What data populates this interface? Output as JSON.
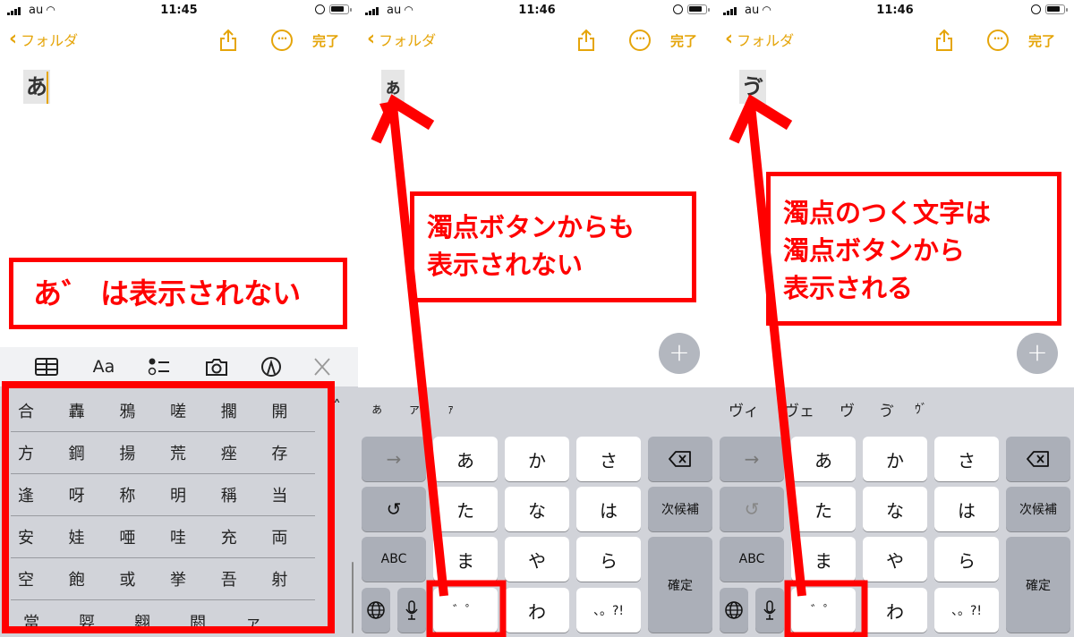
{
  "colors": {
    "accent": "#e5a50a",
    "annotation": "#ff0000",
    "keyboard_bg": "#d1d3d9",
    "key_white": "#ffffff",
    "key_gray": "#abafb8"
  },
  "panels": [
    {
      "status": {
        "carrier": "au",
        "time": "11:45"
      },
      "nav": {
        "back_label": "フォルダ",
        "done_label": "完了"
      },
      "note_text": "あ",
      "toolbar": {
        "icons": [
          "table-icon",
          "text-format-icon",
          "checklist-icon",
          "camera-icon",
          "markup-icon",
          "close-icon"
        ],
        "format_label": "Aa",
        "close_label": "✕"
      },
      "candidates": [
        [
          "合",
          "轟",
          "鴉",
          "嗟",
          "擱",
          "開"
        ],
        [
          "方",
          "鋼",
          "揚",
          "荒",
          "痤",
          "存"
        ],
        [
          "逢",
          "呀",
          "称",
          "明",
          "稱",
          "当"
        ],
        [
          "安",
          "娃",
          "唖",
          "哇",
          "充",
          "両"
        ],
        [
          "空",
          "飽",
          "或",
          "挙",
          "吾",
          "射"
        ],
        [
          "當",
          "娿",
          "翱",
          "閼",
          "ァ"
        ]
      ],
      "callout": [
        "あ゛ は表示されない"
      ]
    },
    {
      "status": {
        "carrier": "au",
        "time": "11:46"
      },
      "nav": {
        "back_label": "フォルダ",
        "done_label": "完了"
      },
      "note_text": "ぁ",
      "candidates": [
        "ぁ",
        "ァ",
        "ｧ"
      ],
      "callout": [
        "濁点ボタンからも",
        "表示されない"
      ]
    },
    {
      "status": {
        "carrier": "au",
        "time": "11:46"
      },
      "nav": {
        "back_label": "フォルダ",
        "done_label": "完了"
      },
      "note_text": "ゔ",
      "candidates": [
        "ヴィ",
        "ヴェ",
        "ヴ",
        "ゔ",
        "ｳﾞ"
      ],
      "callout": [
        "濁点のつく文字は",
        "濁点ボタンから",
        "表示される"
      ]
    }
  ],
  "keyboard": {
    "arrow_label": "→",
    "undo_label": "↺",
    "abc_label": "ABC",
    "next_candidate_label": "次候補",
    "confirm_label": "確定",
    "rows": [
      [
        "あ",
        "か",
        "さ"
      ],
      [
        "た",
        "な",
        "は"
      ],
      [
        "ま",
        "や",
        "ら"
      ],
      [
        "゛゜",
        "わ",
        "、。?!"
      ]
    ],
    "backspace_label": "⌫",
    "globe_label": "🌐",
    "mic_label": "🎤",
    "fab_label": "+"
  }
}
